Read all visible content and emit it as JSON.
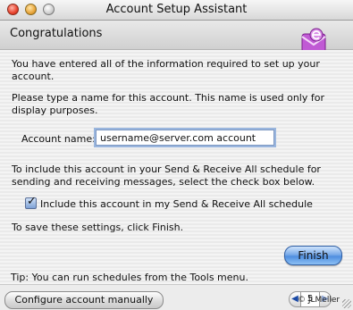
{
  "window": {
    "title": "Account Setup Assistant"
  },
  "header": {
    "title": "Congratulations"
  },
  "body": {
    "intro": "You have entered all of the information required to set up your account.",
    "name_instruction": "Please type a name for this account. This name is used only for display purposes.",
    "account_name_label": "Account name:",
    "account_name_value": "username@server.com account",
    "schedule_instruction": "To include this account in your Send & Receive All schedule for sending and receiving messages, select the check box below.",
    "schedule_checkbox_label": "Include this account in my Send & Receive All schedule",
    "schedule_checkbox_checked": true,
    "save_instruction": "To save these settings, click Finish.",
    "finish_label": "Finish",
    "tip": "Tip: You can run schedules from the Tools menu."
  },
  "footer": {
    "configure_label": "Configure account manually",
    "page_number": "5",
    "prev_icon": "triangle-left-icon",
    "next_icon": "triangle-right-icon"
  },
  "watermark": "© JLMeller",
  "colors": {
    "accent": "#4f8ee0",
    "app_icon": "#b640c9"
  }
}
